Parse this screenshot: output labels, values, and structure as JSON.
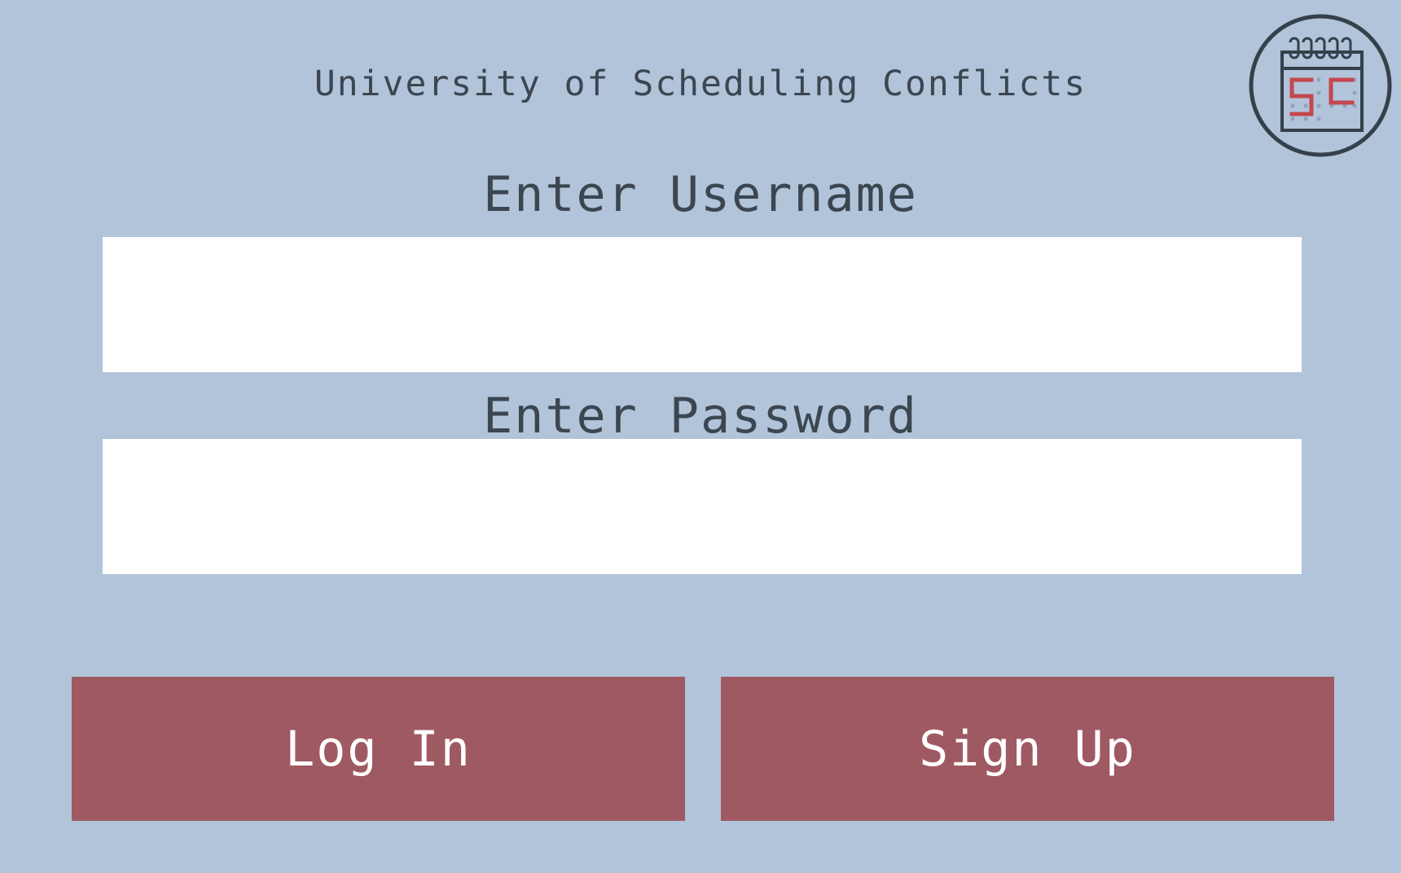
{
  "header": {
    "title": "University of Scheduling Conflicts",
    "logo_icon": "calendar-logo-icon",
    "logo_text": "SC"
  },
  "form": {
    "username_label": "Enter Username",
    "username_value": "",
    "password_label": "Enter Password",
    "password_value": ""
  },
  "actions": {
    "login_label": "Log In",
    "signup_label": "Sign Up"
  },
  "colors": {
    "background": "#b1c4d9",
    "text": "#3b4651",
    "button": "#9f5962",
    "button_text": "#ffffff",
    "field": "#ffffff",
    "logo_accent": "#c4474f"
  }
}
